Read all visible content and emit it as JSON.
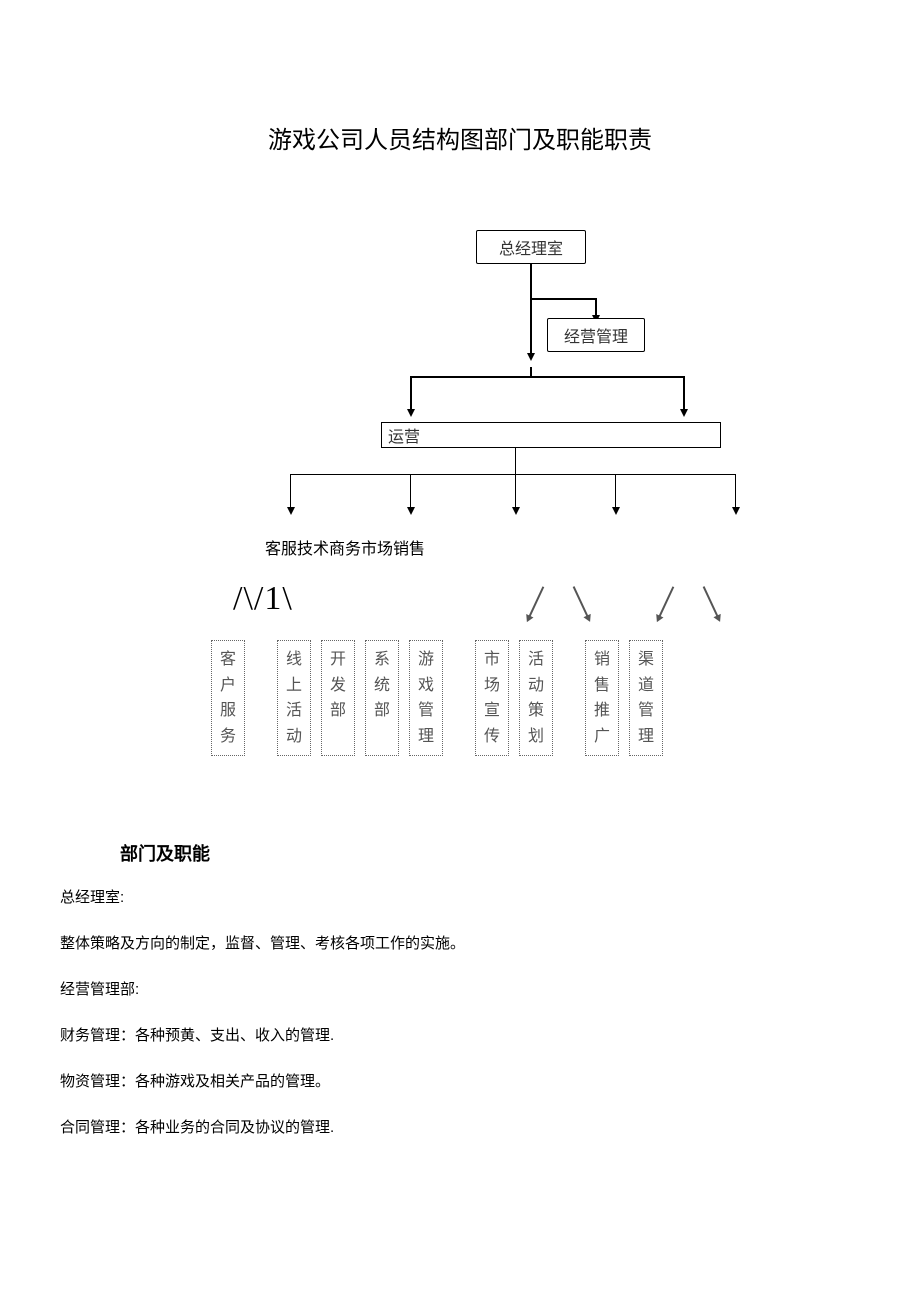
{
  "title": "游戏公司人员结构图部门及职能职责",
  "diagram": {
    "top_box": "总经理室",
    "mgmt_box": "经营管理",
    "operate_box": "运营",
    "mid_labels": "客服技术商务市场销售",
    "slashes": "/\\/1\\",
    "leaf_boxes": [
      "客户服务",
      "线上活动",
      "开发部",
      "系统部",
      "游戏管理",
      "市场宣传",
      "活动策划",
      "销售推广",
      "渠道管理"
    ]
  },
  "section_heading": "部门及职能",
  "paragraphs": [
    "总经理室:",
    "整体策略及方向的制定，监督、管理、考核各项工作的实施。",
    "经营管理部:",
    "财务管理：各种预黄、支出、收入的管理.",
    "物资管理：各种游戏及相关产品的管理。",
    "合同管理：各种业务的合同及协议的管理."
  ]
}
